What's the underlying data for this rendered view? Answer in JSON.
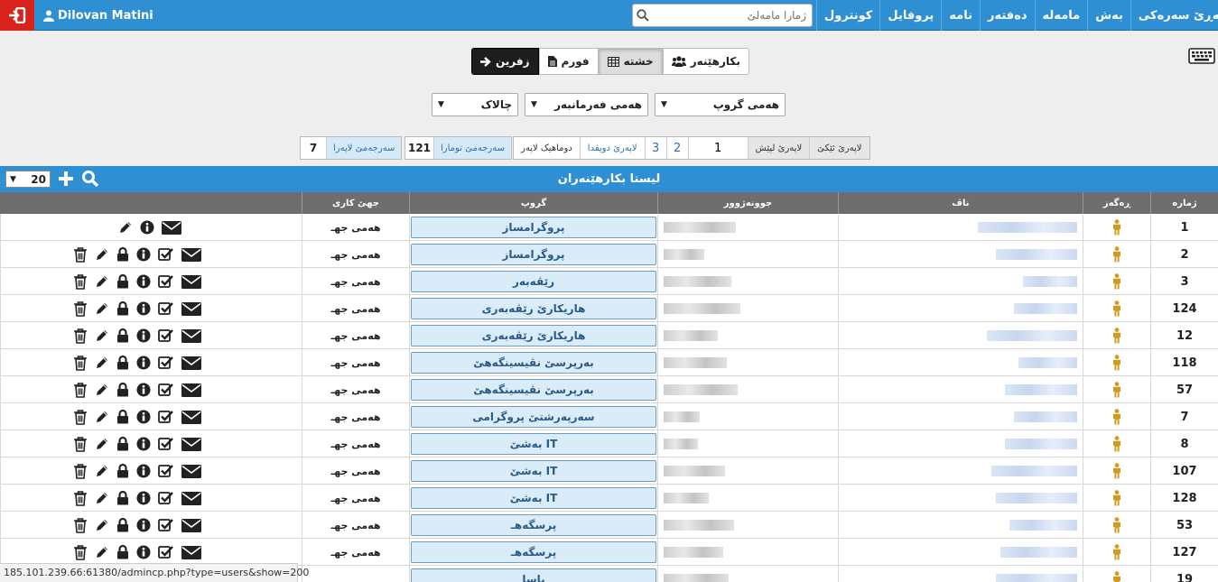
{
  "topbar": {
    "user_name": "Dilovan Matini",
    "search_placeholder": "ژمارا مامەلێ",
    "nav": [
      "لاپەڕێ سەرەکی",
      "بەش",
      "مامەلە",
      "دەفتەر",
      "نامە",
      "پروفایل",
      "کونترول"
    ]
  },
  "views": {
    "back": "زفرین",
    "form": "فورم",
    "grid": "خشتە",
    "users": "بکارهێنەر"
  },
  "filters": {
    "group": "هەمی گروپ",
    "employee": "هەمی فەرمانبەر",
    "status": "چالاک"
  },
  "pager": {
    "first": "لاپەرێ ئێکێ",
    "prev": "لاپەرێ لپێش",
    "current": "1",
    "p2": "2",
    "p3": "3",
    "next": "لاپەرێ دویڤدا",
    "last": "دوماهیک لاپەر"
  },
  "stats": {
    "total_records_label": "سەرجەمێ تومارا",
    "total_records": "121",
    "total_pages_label": "سەرجەمێ لاپەرا",
    "total_pages": "7"
  },
  "list": {
    "title": "لیستا بکارهێنەران",
    "per_page": "20"
  },
  "columns": {
    "number": "ژمارە",
    "type": "ڕەگەز",
    "name": "ناڤ",
    "username": "جوونەژوور",
    "group": "گروپ",
    "scope": "جهێ كاری"
  },
  "rows": [
    {
      "number": "1",
      "group": "پروگرامساز",
      "scope": "هەمی جهـ",
      "full": false
    },
    {
      "number": "2",
      "group": "پروگرامساز",
      "scope": "هەمی جهـ",
      "full": true
    },
    {
      "number": "3",
      "group": "رێڤەبەر",
      "scope": "هەمی جهـ",
      "full": true
    },
    {
      "number": "124",
      "group": "هاریکارێ رێڤەبەری",
      "scope": "هەمی جهـ",
      "full": true
    },
    {
      "number": "12",
      "group": "هاریکارێ رێڤەبەری",
      "scope": "هەمی جهـ",
      "full": true
    },
    {
      "number": "118",
      "group": "بەرپرسێ نڤیسینگەهێ",
      "scope": "هەمی جهـ",
      "full": true
    },
    {
      "number": "57",
      "group": "بەرپرسێ نڤیسینگەهێ",
      "scope": "هەمی جهـ",
      "full": true
    },
    {
      "number": "7",
      "group": "سەرپەرشتێ پروگرامی",
      "scope": "هەمی جهـ",
      "full": true
    },
    {
      "number": "8",
      "group": "بەشێ IT",
      "scope": "هەمی جهـ",
      "full": true
    },
    {
      "number": "107",
      "group": "بەشێ IT",
      "scope": "هەمی جهـ",
      "full": true
    },
    {
      "number": "128",
      "group": "بەشێ IT",
      "scope": "هەمی جهـ",
      "full": true
    },
    {
      "number": "53",
      "group": "پرسگەهـ",
      "scope": "هەمی جهـ",
      "full": true
    },
    {
      "number": "127",
      "group": "پرسگەهـ",
      "scope": "هەمی جهـ",
      "full": true
    },
    {
      "number": "19",
      "group": "پاسا",
      "scope": "",
      "full": true
    }
  ],
  "statusbar": "185.101.239.66:61380/admincp.php?type=users&show=200",
  "colors": {
    "bar_blue": "#2f8fd3",
    "logout_red": "#d9221b",
    "person_icon": "#d29a1e"
  },
  "icons": {
    "logout": "logout-icon",
    "user": "user-icon",
    "search": "search-icon",
    "keyboard": "keyboard-icon",
    "actions": [
      "trash-icon",
      "pencil-icon",
      "lock-icon",
      "info-icon",
      "checkbox-icon",
      "envelope-icon"
    ],
    "type": "person-icon"
  }
}
